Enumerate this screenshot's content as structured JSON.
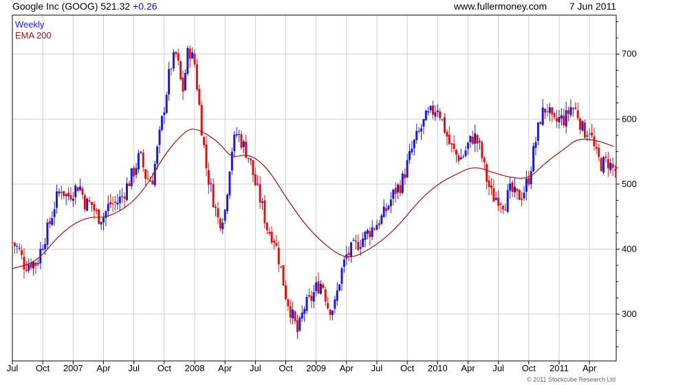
{
  "header": {
    "title": "Google Inc (GOOG) 521.32",
    "change": "+0.26",
    "site": "www.fullermoney.com",
    "date": "7 Jun 2011"
  },
  "footer": {
    "copyright": "© 2011 Stockcube Research Ltd"
  },
  "colors": {
    "up": "#1a1ad6",
    "down": "#e01010",
    "ema": "#a01010",
    "grid": "#cfcfcf"
  },
  "chart_data": {
    "type": "candlestick",
    "title": "Google Inc (GOOG) 521.32 +0.26",
    "frequency_label": "Weekly",
    "legend": [
      {
        "name": "Weekly",
        "color": "#1a1ad6"
      },
      {
        "name": "EMA 200",
        "color": "#a01010"
      }
    ],
    "legend_position": "top-left",
    "y_axis": {
      "position": "right",
      "ylim": [
        228,
        760
      ],
      "ticks": [
        300,
        400,
        500,
        600,
        700
      ]
    },
    "x_axis": {
      "range": [
        2006.5,
        2011.47
      ],
      "tick_labels": [
        {
          "label": "Jul",
          "t": 2006.5
        },
        {
          "label": "Oct",
          "t": 2006.75
        },
        {
          "label": "2007",
          "t": 2007.0
        },
        {
          "label": "Apr",
          "t": 2007.25
        },
        {
          "label": "Jul",
          "t": 2007.5
        },
        {
          "label": "Oct",
          "t": 2007.75
        },
        {
          "label": "2008",
          "t": 2008.0
        },
        {
          "label": "Apr",
          "t": 2008.25
        },
        {
          "label": "Jul",
          "t": 2008.5
        },
        {
          "label": "Oct",
          "t": 2008.75
        },
        {
          "label": "2009",
          "t": 2009.0
        },
        {
          "label": "Apr",
          "t": 2009.25
        },
        {
          "label": "Jul",
          "t": 2009.5
        },
        {
          "label": "Oct",
          "t": 2009.75
        },
        {
          "label": "2010",
          "t": 2010.0
        },
        {
          "label": "Apr",
          "t": 2010.25
        },
        {
          "label": "Jul",
          "t": 2010.5
        },
        {
          "label": "Oct",
          "t": 2010.75
        },
        {
          "label": "2011",
          "t": 2011.0
        },
        {
          "label": "Apr",
          "t": 2011.25
        }
      ]
    },
    "grid": true,
    "price_series": {
      "name": "Weekly",
      "points": [
        [
          2006.5,
          410
        ],
        [
          2006.55,
          400
        ],
        [
          2006.6,
          375
        ],
        [
          2006.65,
          380
        ],
        [
          2006.7,
          378
        ],
        [
          2006.75,
          410
        ],
        [
          2006.8,
          435
        ],
        [
          2006.85,
          470
        ],
        [
          2006.9,
          495
        ],
        [
          2006.95,
          480
        ],
        [
          2007.0,
          490
        ],
        [
          2007.05,
          500
        ],
        [
          2007.1,
          470
        ],
        [
          2007.15,
          470
        ],
        [
          2007.2,
          450
        ],
        [
          2007.25,
          450
        ],
        [
          2007.3,
          470
        ],
        [
          2007.35,
          470
        ],
        [
          2007.4,
          480
        ],
        [
          2007.45,
          500
        ],
        [
          2007.5,
          520
        ],
        [
          2007.55,
          545
        ],
        [
          2007.6,
          510
        ],
        [
          2007.65,
          505
        ],
        [
          2007.7,
          560
        ],
        [
          2007.75,
          620
        ],
        [
          2007.8,
          680
        ],
        [
          2007.85,
          700
        ],
        [
          2007.9,
          640
        ],
        [
          2007.95,
          710
        ],
        [
          2008.0,
          685
        ],
        [
          2008.05,
          600
        ],
        [
          2008.1,
          520
        ],
        [
          2008.15,
          480
        ],
        [
          2008.2,
          440
        ],
        [
          2008.25,
          460
        ],
        [
          2008.3,
          550
        ],
        [
          2008.35,
          580
        ],
        [
          2008.4,
          560
        ],
        [
          2008.45,
          540
        ],
        [
          2008.5,
          500
        ],
        [
          2008.55,
          470
        ],
        [
          2008.6,
          430
        ],
        [
          2008.65,
          420
        ],
        [
          2008.7,
          380
        ],
        [
          2008.75,
          330
        ],
        [
          2008.8,
          300
        ],
        [
          2008.85,
          270
        ],
        [
          2008.9,
          310
        ],
        [
          2008.95,
          320
        ],
        [
          2009.0,
          340
        ],
        [
          2009.05,
          350
        ],
        [
          2009.1,
          310
        ],
        [
          2009.15,
          310
        ],
        [
          2009.2,
          360
        ],
        [
          2009.25,
          390
        ],
        [
          2009.3,
          400
        ],
        [
          2009.35,
          410
        ],
        [
          2009.4,
          420
        ],
        [
          2009.45,
          430
        ],
        [
          2009.5,
          440
        ],
        [
          2009.55,
          450
        ],
        [
          2009.6,
          470
        ],
        [
          2009.65,
          490
        ],
        [
          2009.7,
          500
        ],
        [
          2009.75,
          530
        ],
        [
          2009.8,
          560
        ],
        [
          2009.85,
          580
        ],
        [
          2009.9,
          600
        ],
        [
          2009.95,
          610
        ],
        [
          2010.0,
          620
        ],
        [
          2010.05,
          590
        ],
        [
          2010.1,
          560
        ],
        [
          2010.15,
          545
        ],
        [
          2010.2,
          540
        ],
        [
          2010.25,
          560
        ],
        [
          2010.3,
          575
        ],
        [
          2010.35,
          555
        ],
        [
          2010.4,
          510
        ],
        [
          2010.45,
          480
        ],
        [
          2010.5,
          480
        ],
        [
          2010.55,
          470
        ],
        [
          2010.6,
          490
        ],
        [
          2010.65,
          480
        ],
        [
          2010.7,
          485
        ],
        [
          2010.75,
          510
        ],
        [
          2010.8,
          560
        ],
        [
          2010.85,
          605
        ],
        [
          2010.9,
          620
        ],
        [
          2010.95,
          590
        ],
        [
          2011.0,
          600
        ],
        [
          2011.05,
          600
        ],
        [
          2011.1,
          620
        ],
        [
          2011.15,
          610
        ],
        [
          2011.2,
          580
        ],
        [
          2011.25,
          585
        ],
        [
          2011.3,
          545
        ],
        [
          2011.35,
          530
        ],
        [
          2011.4,
          535
        ],
        [
          2011.45,
          521
        ]
      ]
    },
    "ema_series": {
      "name": "EMA 200",
      "points": [
        [
          2006.5,
          370
        ],
        [
          2006.7,
          380
        ],
        [
          2006.9,
          425
        ],
        [
          2007.1,
          450
        ],
        [
          2007.3,
          448
        ],
        [
          2007.55,
          480
        ],
        [
          2007.75,
          545
        ],
        [
          2007.9,
          578
        ],
        [
          2008.0,
          588
        ],
        [
          2008.2,
          565
        ],
        [
          2008.3,
          540
        ],
        [
          2008.45,
          547
        ],
        [
          2008.6,
          525
        ],
        [
          2008.75,
          480
        ],
        [
          2008.9,
          440
        ],
        [
          2009.05,
          410
        ],
        [
          2009.25,
          383
        ],
        [
          2009.45,
          400
        ],
        [
          2009.65,
          430
        ],
        [
          2009.85,
          475
        ],
        [
          2010.0,
          500
        ],
        [
          2010.15,
          515
        ],
        [
          2010.3,
          528
        ],
        [
          2010.45,
          518
        ],
        [
          2010.6,
          510
        ],
        [
          2010.75,
          508
        ],
        [
          2010.9,
          535
        ],
        [
          2011.05,
          555
        ],
        [
          2011.15,
          570
        ],
        [
          2011.3,
          568
        ],
        [
          2011.45,
          558
        ]
      ]
    }
  }
}
